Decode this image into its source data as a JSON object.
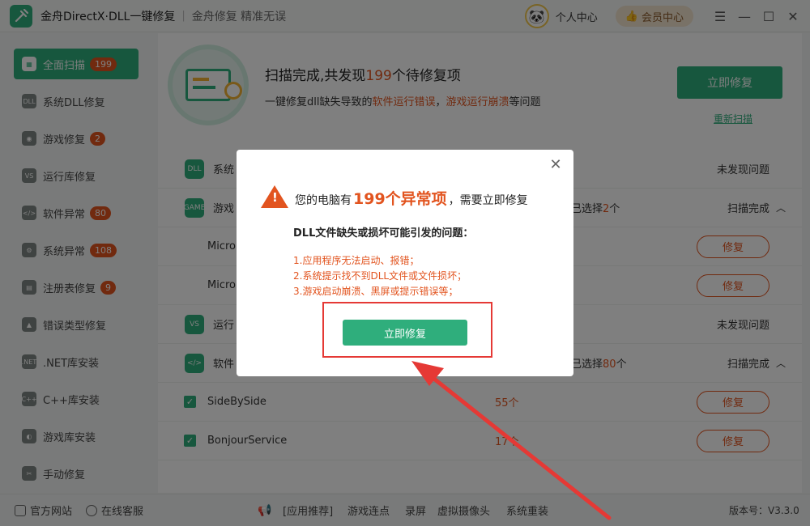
{
  "titlebar": {
    "app_title": "金舟DirectX·DLL一键修复",
    "separator": "|",
    "slogan": "金舟修复 精准无误",
    "personal_center": "个人中心",
    "vip_center": "会员中心"
  },
  "sidebar": {
    "items": [
      {
        "label": "全面扫描",
        "badge": "199",
        "icon": "scan-icon"
      },
      {
        "label": "系统DLL修复",
        "badge": "",
        "icon": "dll-icon"
      },
      {
        "label": "游戏修复",
        "badge": "2",
        "icon": "gamepad-icon"
      },
      {
        "label": "运行库修复",
        "badge": "",
        "icon": "runtime-icon"
      },
      {
        "label": "软件异常",
        "badge": "80",
        "icon": "code-icon"
      },
      {
        "label": "系统异常",
        "badge": "108",
        "icon": "gear-icon"
      },
      {
        "label": "注册表修复",
        "badge": "9",
        "icon": "registry-icon"
      },
      {
        "label": "错误类型修复",
        "badge": "",
        "icon": "warning-icon"
      },
      {
        "label": ".NET库安装",
        "badge": "",
        "icon": "dotnet-icon"
      },
      {
        "label": "C++库安装",
        "badge": "",
        "icon": "cpp-icon"
      },
      {
        "label": "游戏库安装",
        "badge": "",
        "icon": "pacman-icon"
      },
      {
        "label": "手动修复",
        "badge": "",
        "icon": "wrench-icon"
      }
    ]
  },
  "scan": {
    "title_pre": "扫描完成,共发现",
    "title_count": "199",
    "title_post": "个待修复项",
    "desc_pre": "一键修复dll缺失导致的",
    "desc_hl1": "软件运行错误",
    "desc_sep": "，",
    "desc_hl2": "游戏运行崩溃",
    "desc_post": "等问题",
    "fix_now": "立即修复",
    "rescan": "重新扫描"
  },
  "list": {
    "rows": [
      {
        "name": "系统",
        "mid_pre": "",
        "mid_hl": "",
        "mid_post": "",
        "status": "未发现问题",
        "chevron": "",
        "icon": "DLL"
      },
      {
        "name": "游戏",
        "mid_pre": "已选择",
        "mid_hl": "2",
        "mid_post": "个",
        "status": "扫描完成",
        "chevron": "^",
        "icon": "GAME"
      },
      {
        "name": "Micro",
        "count": "",
        "repair": "修复"
      },
      {
        "name": "Micro",
        "count": "",
        "repair": "修复"
      },
      {
        "name": "运行",
        "mid_pre": "",
        "mid_hl": "",
        "mid_post": "",
        "status": "未发现问题",
        "chevron": "",
        "icon": "VS"
      },
      {
        "name": "软件",
        "mid_pre": "已选择",
        "mid_hl": "80",
        "mid_post": "个",
        "status": "扫描完成",
        "chevron": "^",
        "icon": "</>"
      },
      {
        "name": "SideBySide",
        "count": "55个",
        "repair": "修复"
      },
      {
        "name": "BonjourService",
        "count": "17个",
        "repair": "修复"
      }
    ]
  },
  "footer": {
    "website": "官方网站",
    "service": "在线客服",
    "recommend": "[应用推荐]",
    "links": [
      "游戏连点",
      "录屏",
      "虚拟摄像头",
      "系统重装"
    ],
    "version": "版本号：V3.3.0"
  },
  "dialog": {
    "title_pre": "您的电脑有",
    "title_count": "199个异常项",
    "title_post": "，需要立即修复",
    "subtitle": "DLL文件缺失或损坏可能引发的问题：",
    "lines": [
      "1.应用程序无法启动、报错；",
      "2.系统提示找不到DLL文件或文件损坏；",
      "3.游戏启动崩溃、黑屏或提示错误等；"
    ],
    "button": "立即修复"
  },
  "colors": {
    "brand_green": "#2fae7c",
    "accent_orange": "#e2541f",
    "annotation_red": "#e53935"
  }
}
